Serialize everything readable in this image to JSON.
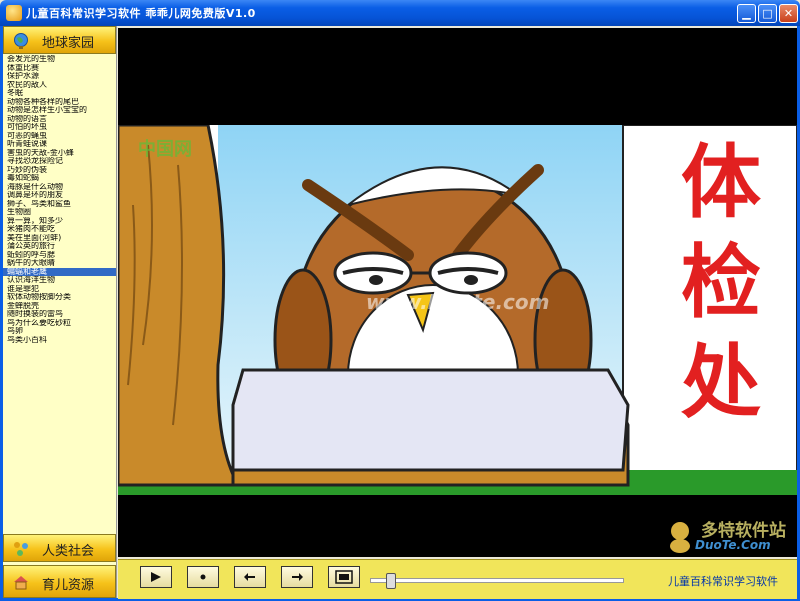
{
  "window": {
    "title": "儿童百科常识学习软件 乖乖儿网免费版V1.0"
  },
  "sidebar": {
    "top_button": "地球家园",
    "items": [
      "会发光的生物",
      "体重比赛",
      "保护水源",
      "农民的敌人",
      "冬眠",
      "动物各种各样的尾巴",
      "动物是怎样生小宝宝的",
      "动物的语言",
      "可怕的坏虫",
      "可恶的蝇虫",
      "听青蛙说课",
      "害虫的天敌-金小蜂",
      "寻找恐龙探险记",
      "巧妙的伪装",
      "毒如蛇蝎",
      "海豚是什么动物",
      "调鼻是环的朋友",
      "狮子、鸟类和鲨鱼",
      "生物圈",
      "算一算，知多少",
      "米猪肉不能吃",
      "美在里面(河蚌)",
      "蒲公英的旅行",
      "蚯蚓的呼与腮",
      "蜗牛的大眼睛",
      "蝙蝠和老鹰",
      "认识海洋生物",
      "谁是罪犯",
      "软体动物按脚分类",
      "金蝉脱壳",
      "随时换装的雷鸟",
      "鸟为什么要吃砂粒",
      "鸟卵",
      "鸟类小百科"
    ],
    "selected_index": 25,
    "bottom_buttons": [
      "人类社会",
      "育儿资源"
    ]
  },
  "video": {
    "watermark_text": "中国网",
    "sign_text": [
      "体",
      "检",
      "处"
    ],
    "center_watermark": "www.Duote.com"
  },
  "controls": {
    "status_label": "儿童百科常识学习软件",
    "seek_position": 0.06,
    "watermark_top": "多特软件站",
    "watermark_bottom": "DuoTe.Com"
  },
  "colors": {
    "titlebar": "#0a5ee6",
    "sidebar_bg": "#ffffc6",
    "control_bar": "#f1e55a",
    "selection": "#316ac5"
  }
}
